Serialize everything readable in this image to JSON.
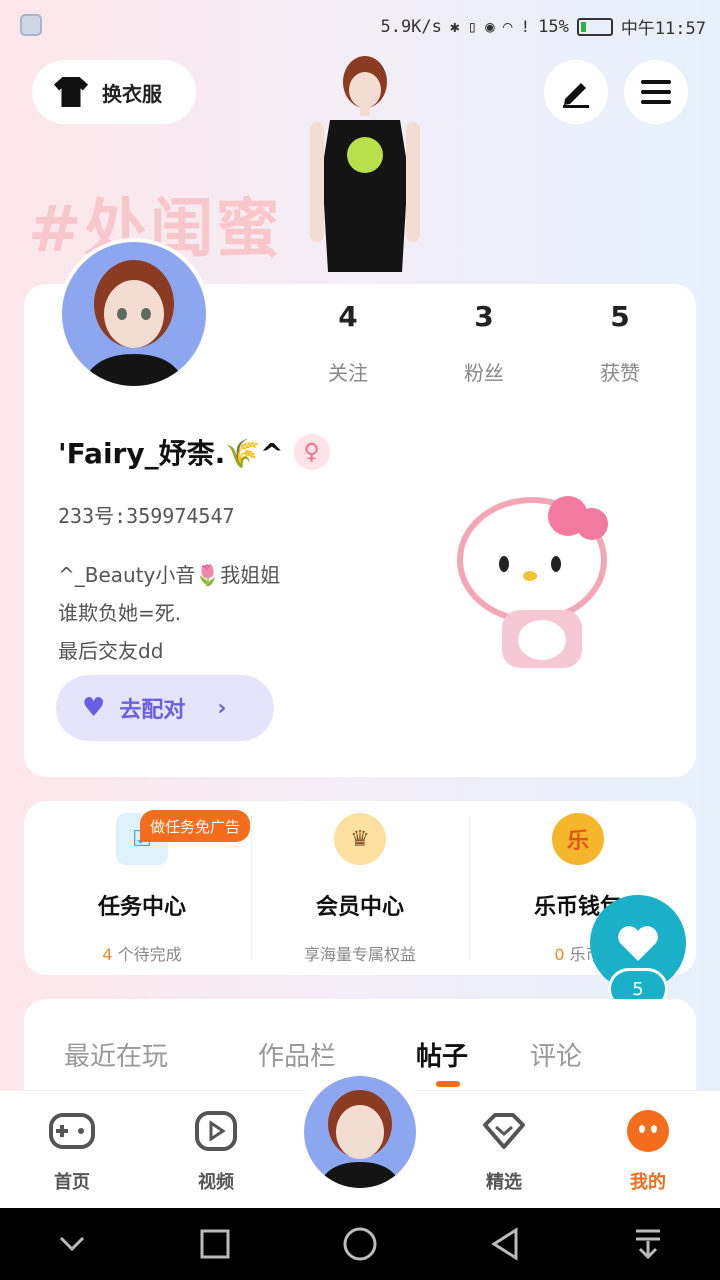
{
  "status_bar": {
    "net_speed": "5.9K/s",
    "battery_percent": "15%",
    "time": "中午11:57"
  },
  "header": {
    "wardrobe_label": "换衣服",
    "edit_icon": "pen-icon",
    "menu_icon": "hamburger-icon",
    "tag_text": "#处闺蜜"
  },
  "profile": {
    "stats": [
      {
        "value": "4",
        "label": "关注"
      },
      {
        "value": "3",
        "label": "粉丝"
      },
      {
        "value": "5",
        "label": "获赞"
      }
    ],
    "nickname": "'Fairy_妤柰.🌾^",
    "gender_symbol": "♀",
    "uid": "233号:359974547",
    "bio_lines": [
      "^_Beauty小音🌷我姐姐",
      "谁欺负她=死.",
      "最后交友dd"
    ],
    "match_button": "去配对"
  },
  "tasks": {
    "ad_badge": "做任务免广告",
    "columns": [
      {
        "title": "任务中心",
        "sub_count": "4",
        "sub_text": "个待完成",
        "icon": "clipboard-icon"
      },
      {
        "title": "会员中心",
        "sub_count": "",
        "sub_text": "享海量专属权益",
        "icon": "crown-icon"
      },
      {
        "title": "乐币钱包",
        "sub_count": "0",
        "sub_text": "乐币",
        "icon": "coin-icon"
      }
    ]
  },
  "floating_like": {
    "count": "5"
  },
  "content_tabs": [
    "最近在玩",
    "作品栏",
    "帖子",
    "评论"
  ],
  "bottom_nav": [
    {
      "label": "首页",
      "icon": "gamepad-icon"
    },
    {
      "label": "视频",
      "icon": "play-icon"
    },
    {
      "label": "精选",
      "icon": "heart-diamond-icon"
    },
    {
      "label": "我的",
      "icon": "face-icon"
    }
  ],
  "colors": {
    "accent": "#f36d1c",
    "teal": "#1ab1c8",
    "purple": "#6a5fe0"
  }
}
